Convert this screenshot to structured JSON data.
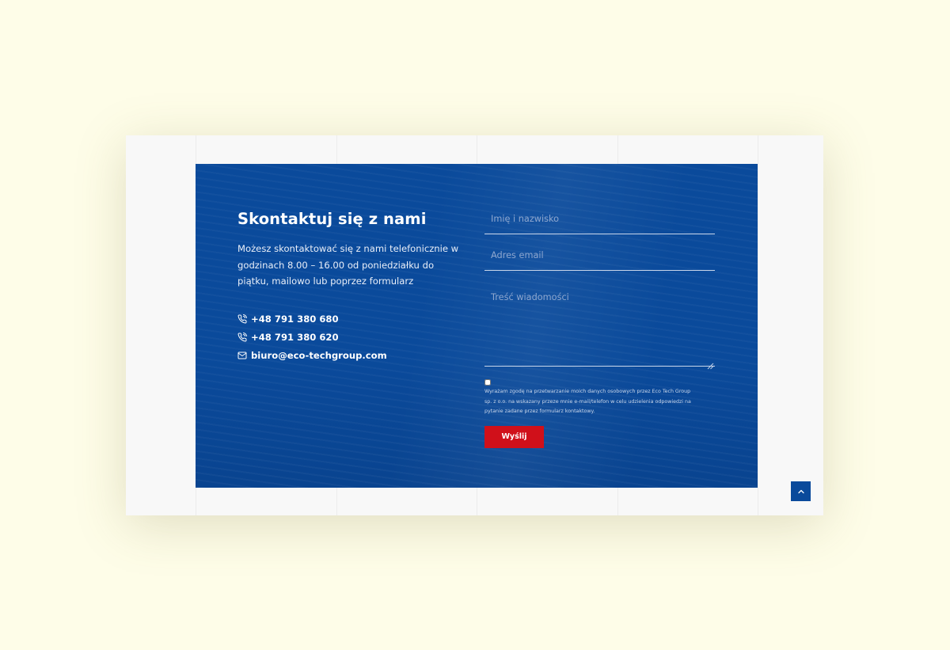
{
  "contact_section": {
    "title": "Skontaktuj się z nami",
    "description": "Możesz skontaktować się z nami telefonicznie w godzinach 8.00 – 16.00 od poniedziałku do piątku, mailowo lub poprzez formularz",
    "phone_1": "+48 791 380 680",
    "phone_2": "+48 791 380 620",
    "email": "biuro@eco-techgroup.com",
    "phone_icon": "phone-icon",
    "email_icon": "envelope-icon"
  },
  "form": {
    "name_placeholder": "Imię i nazwisko",
    "name_value": "",
    "email_placeholder": "Adres email",
    "email_value": "",
    "message_placeholder": "Treść wiadomości",
    "message_value": "",
    "consent_checked": false,
    "consent_text": "Wyrażam zgodę na przetwarzanie moich danych osobowych przez Eco Tech Group sp. z o.o. na wskazany przeze mnie e-mail/telefon w celu udzielenia odpowiedzi na pytanie zadane przez formularz kontaktowy.",
    "submit_label": "Wyślij"
  },
  "scroll_top": {
    "icon": "chevron-up-icon"
  },
  "colors": {
    "page_background": "#fefde8",
    "frame_background": "#f8f8f8",
    "panel_blue": "#0a4a9b",
    "submit_red": "#d0101a",
    "text_white": "#ffffff",
    "placeholder": "#8ea7cf"
  }
}
